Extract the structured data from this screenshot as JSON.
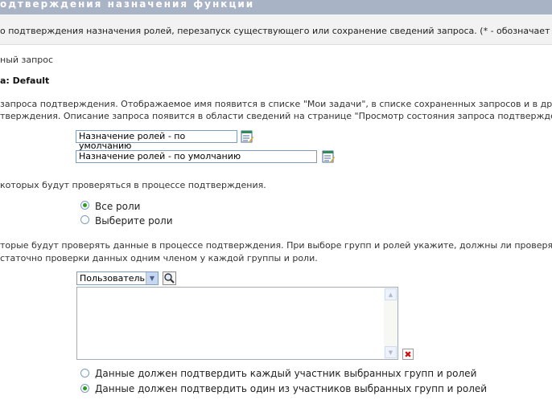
{
  "header": {
    "title": "одтверждения назначения функции"
  },
  "intro": {
    "text": "о подтверждения назначения ролей, перезапуск существующего или сохранение сведений запроса.",
    "required_note": "(* - обозначает обяза"
  },
  "request": {
    "label": "ный запрос",
    "name": "а: Default"
  },
  "description": {
    "line1": "запроса подтверждения. Отображаемое имя появится в списке \"Мои задачи\", в списке сохраненных запросов и в други",
    "line2": "тверждения. Описание запроса появится в области сведений на странице \"Просмотр состояния запроса подтверждени",
    "display_name_value": "Назначение ролей - по умолчанию",
    "description_value": "Назначение ролей - по умолчанию"
  },
  "roles": {
    "prompt": "которых будут проверяться в процессе подтверждения.",
    "options": [
      "Все роли",
      "Выберите роли"
    ],
    "selected_index": 0
  },
  "reviewers": {
    "prompt_line1": "торые будут проверять данные в процессе подтверждения. При выборе групп и ролей укажите, должны ли проверять да",
    "prompt_line2": "статочно проверки данных одним членом у каждой группы и роли.",
    "type_selected": "Пользователь",
    "options": [
      "Данные должен подтвердить каждый участник выбранных групп и ролей",
      "Данные должен подтвердить один из участников выбранных групп и ролей"
    ],
    "selected_index": 1
  },
  "colors": {
    "header_band": "#a8b3c6",
    "radio_dot": "#21a121",
    "delete_x": "#d01010"
  }
}
